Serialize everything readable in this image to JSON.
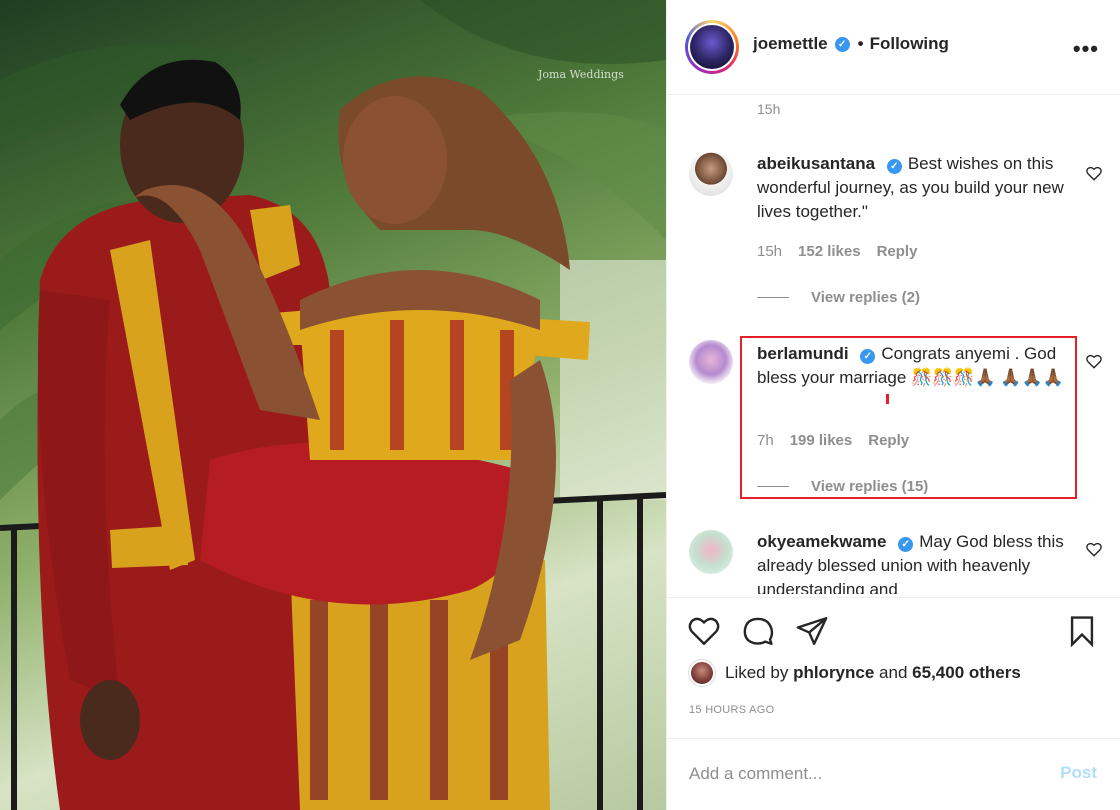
{
  "photo": {
    "watermark": "Joma Weddings",
    "description_icon": "wedding-photo"
  },
  "header": {
    "username": "joemettle",
    "verified_icon": "verified-badge-icon",
    "separator": "•",
    "follow_status": "Following",
    "more_icon": "more-options-icon"
  },
  "top_time": "15h",
  "comments": [
    {
      "username": "abeikusantana",
      "verified": true,
      "text": "Best wishes on this wonderful journey, as you build your new lives together.\"",
      "time": "15h",
      "likes": "152 likes",
      "reply": "Reply",
      "view_replies": "View replies (2)"
    },
    {
      "username": "berlamundi",
      "verified": true,
      "text": "Congrats anyemi . God bless your marriage 🎊🎊🎊🙏🏾 🙏🏾🙏🏾🙏🏾",
      "time": "7h",
      "likes": "199 likes",
      "reply": "Reply",
      "view_replies": "View replies (15)"
    },
    {
      "username": "okyeamekwame",
      "verified": true,
      "text": "May God bless this already blessed union with heavenly understanding and"
    }
  ],
  "actions": {
    "like_icon": "heart-icon",
    "comment_icon": "comment-icon",
    "share_icon": "share-icon",
    "save_icon": "bookmark-icon"
  },
  "likes": {
    "prefix": "Liked by ",
    "user": "phlorynce",
    "middle": " and ",
    "others": "65,400 others"
  },
  "timestamp": "15 HOURS AGO",
  "add_comment": {
    "placeholder": "Add a comment...",
    "post_label": "Post"
  },
  "colors": {
    "verified": "#3897f0",
    "highlight_border": "#e5202a",
    "post_disabled": "#b2dffc",
    "muted": "#8e8e8e"
  }
}
